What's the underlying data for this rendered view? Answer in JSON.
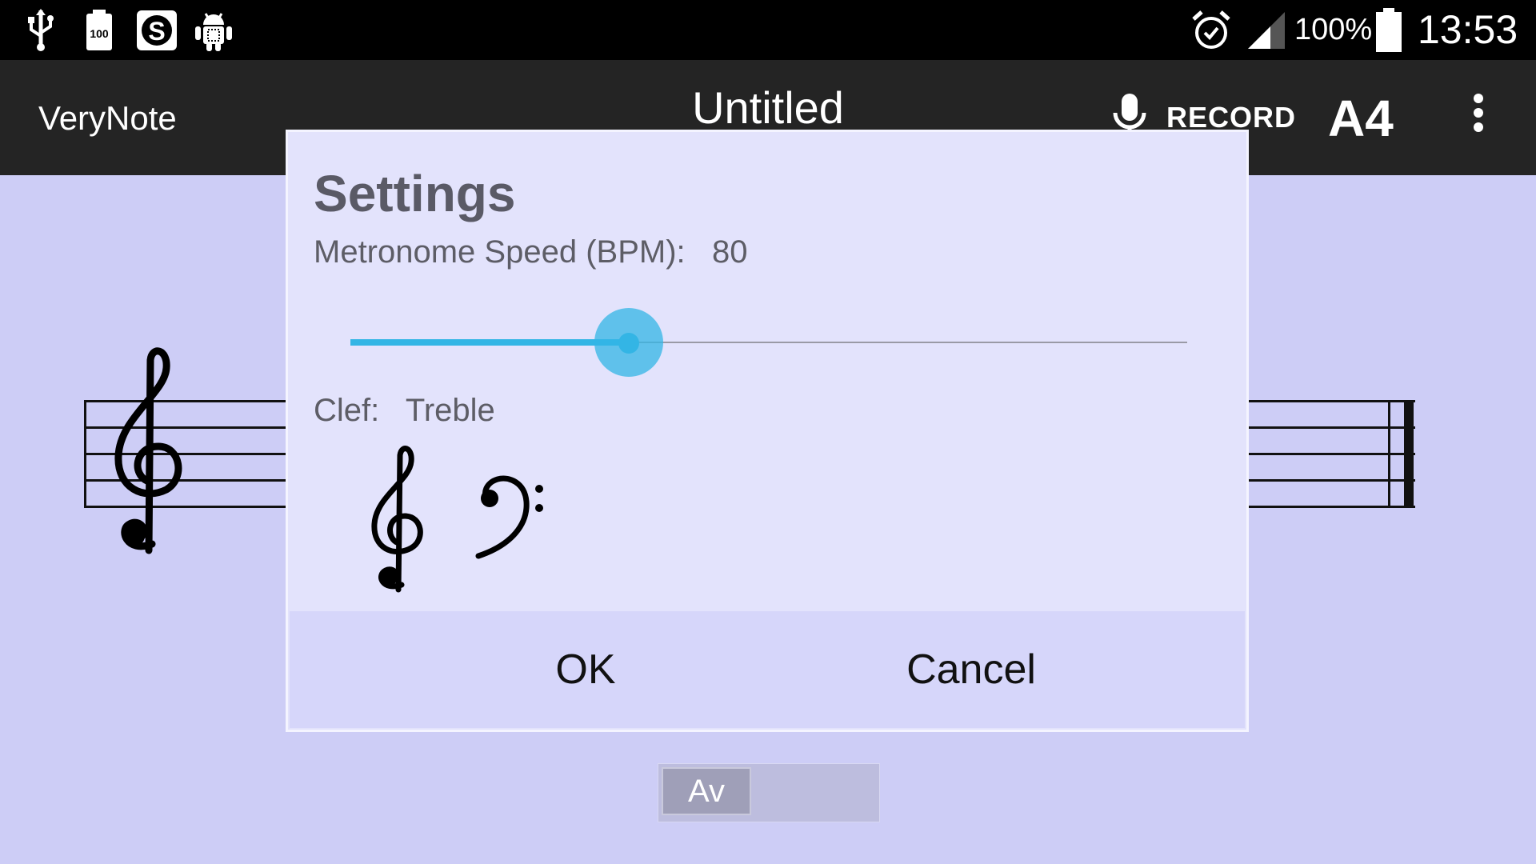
{
  "status_bar": {
    "battery_percent": "100%",
    "time": "13:53",
    "icons": [
      "usb-icon",
      "battery-saver-icon",
      "s-app-icon",
      "android-debug-icon",
      "alarm-icon",
      "signal-icon",
      "battery-icon"
    ],
    "battery_saver_label": "100"
  },
  "action_bar": {
    "app_name": "VeryNote",
    "document_title": "Untitled",
    "record_label": "RECORD",
    "pitch_label": "A4",
    "icons": [
      "microphone-icon",
      "overflow-menu-icon"
    ]
  },
  "dialog": {
    "title": "Settings",
    "metronome_label": "Metronome Speed (BPM):",
    "metronome_value": "80",
    "slider_fraction": 0.333,
    "clef_label": "Clef:",
    "clef_value": "Treble",
    "clef_options": [
      "treble-clef",
      "bass-clef"
    ],
    "ok_label": "OK",
    "cancel_label": "Cancel"
  },
  "bottom_bar": {
    "av_label": "Av"
  },
  "colors": {
    "background": "#cdcdf6",
    "dialog_bg": "#e3e3fc",
    "accent": "#33b5e5",
    "action_bar": "#242424"
  }
}
